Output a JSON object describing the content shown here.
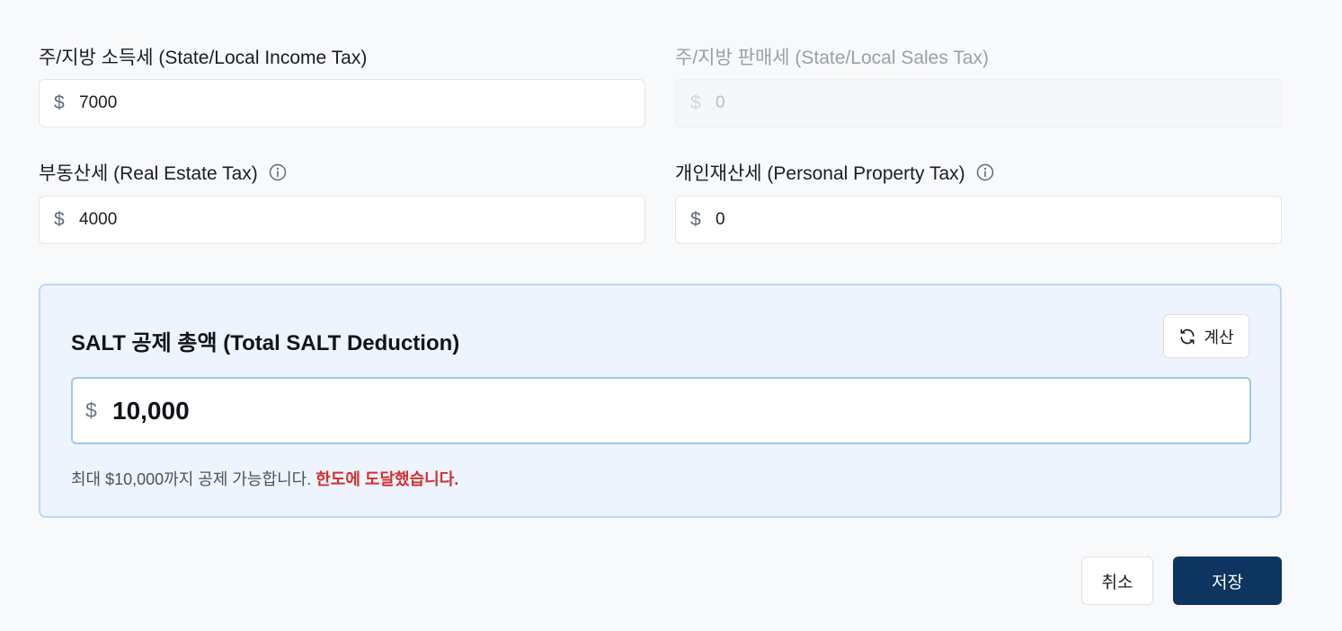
{
  "fields": {
    "state_income": {
      "label": "주/지방 소득세 (State/Local Income Tax)",
      "currency": "$",
      "value": "7000"
    },
    "state_sales": {
      "label": "주/지방 판매세 (State/Local Sales Tax)",
      "currency": "$",
      "value": "0",
      "disabled": true
    },
    "real_estate": {
      "label": "부동산세 (Real Estate Tax)",
      "currency": "$",
      "value": "4000"
    },
    "personal_property": {
      "label": "개인재산세 (Personal Property Tax)",
      "currency": "$",
      "value": "0"
    }
  },
  "salt": {
    "title": "SALT 공제 총액 (Total SALT Deduction)",
    "calc_label": "계산",
    "currency": "$",
    "total": "10,000",
    "note": "최대 $10,000까지 공제 가능합니다.",
    "warning": "한도에 도달했습니다."
  },
  "actions": {
    "cancel_label": "취소",
    "save_label": "저장"
  },
  "colors": {
    "primary": "#0e3460",
    "panel_bg": "#edf4fd",
    "panel_border": "#bcd8f3",
    "warning": "#d32f2f"
  }
}
